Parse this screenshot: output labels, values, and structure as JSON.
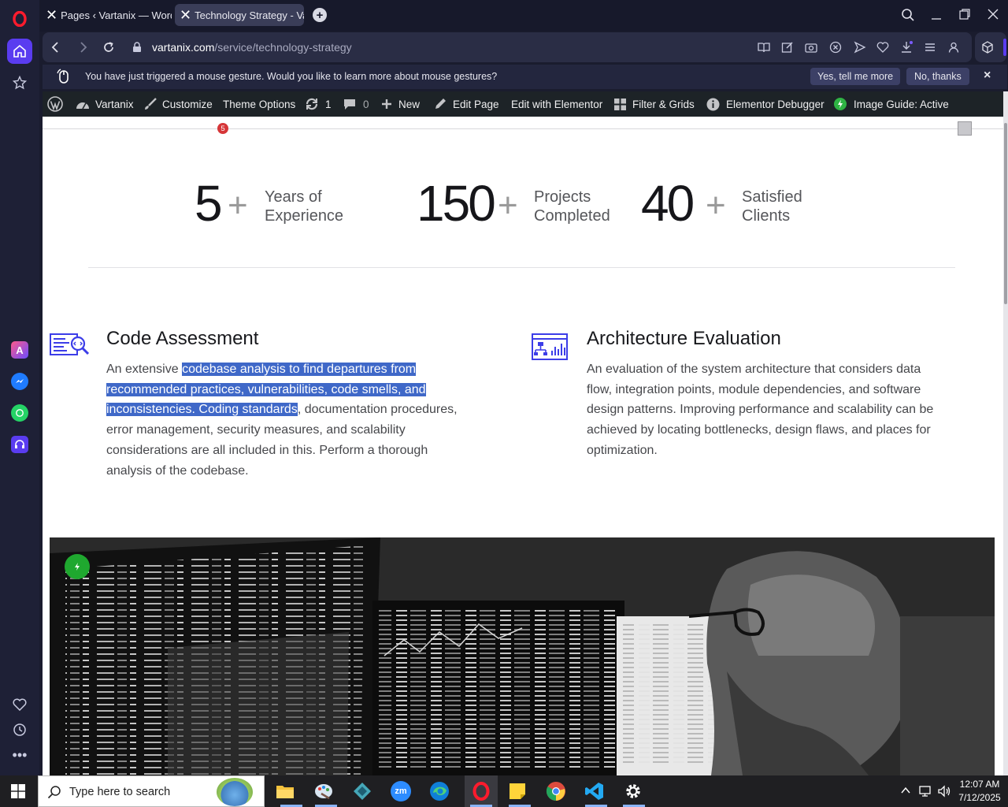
{
  "browser": {
    "tabs": [
      {
        "label": "Pages ‹ Vartanix — WordP"
      },
      {
        "label": "Technology Strategy - Var"
      }
    ],
    "url_domain": "vartanix.com",
    "url_path": "/service/technology-strategy"
  },
  "gesture_bar": {
    "message": "You have just triggered a mouse gesture. Would you like to learn more about mouse gestures?",
    "yes_label": "Yes, tell me more",
    "no_label": "No, thanks",
    "close_label": "×"
  },
  "wp_admin_bar": {
    "site": "Vartanix",
    "customize": "Customize",
    "theme_options": "Theme Options",
    "updates_count": "1",
    "comments_count": "0",
    "new": "New",
    "edit_page": "Edit Page",
    "edit_elementor": "Edit with Elementor",
    "filter_grids": "Filter & Grids",
    "elementor_debugger": "Elementor Debugger",
    "image_guide": "Image Guide: Active",
    "second_row_badge": "5"
  },
  "stats": [
    {
      "number": "5",
      "plus": "+",
      "label_line1": "Years of",
      "label_line2": "Experience"
    },
    {
      "number": "150",
      "plus": "+",
      "label_line1": "Projects",
      "label_line2": "Completed"
    },
    {
      "number": "40",
      "plus": "+",
      "label_line1": "Satisfied",
      "label_line2": "Clients"
    }
  ],
  "services": [
    {
      "title": "Code Assessment",
      "body_before": "An extensive ",
      "body_highlight": "codebase analysis to find departures from recommended practices, vulnerabilities, code smells, and inconsistencies. Coding standards",
      "body_after": ", documentation procedures, error management, security measures, and scalability considerations are all included in this. Perform a thorough analysis of the codebase."
    },
    {
      "title": "Architecture Evaluation",
      "body": "An evaluation of the system architecture that considers data flow, integration points, module dependencies, and software design patterns. Improving performance and scalability can be achieved by locating bottlenecks, design flaws, and places for optimization."
    }
  ],
  "taskbar": {
    "search_placeholder": "Type here to search",
    "time": "12:07 AM",
    "date": "7/12/2025"
  },
  "colors": {
    "accent": "#3f68c8",
    "browser_bg": "#1a1c2e",
    "wp_bar": "#1d2327",
    "icon_blue": "#3c3de8"
  }
}
